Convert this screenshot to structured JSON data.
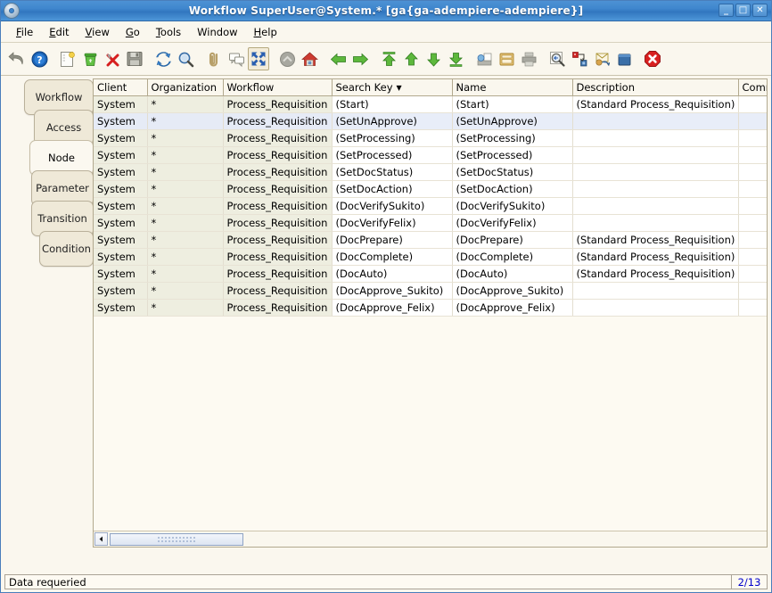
{
  "window": {
    "title": "Workflow  SuperUser@System.* [ga{ga-adempiere-adempiere}]",
    "icon": "disc-icon",
    "buttons": {
      "minimize": "_",
      "maximize": "□",
      "close": "✕"
    }
  },
  "menu": [
    {
      "label": "File",
      "mnemonic": "F"
    },
    {
      "label": "Edit",
      "mnemonic": "E"
    },
    {
      "label": "View",
      "mnemonic": "V"
    },
    {
      "label": "Go",
      "mnemonic": "G"
    },
    {
      "label": "Tools",
      "mnemonic": "T"
    },
    {
      "label": "Window",
      "mnemonic": ""
    },
    {
      "label": "Help",
      "mnemonic": "H"
    }
  ],
  "toolbar": [
    {
      "name": "undo-icon",
      "tooltip": "Undo"
    },
    {
      "name": "help-icon",
      "tooltip": "Help"
    },
    {
      "name": "new-record-icon",
      "tooltip": "New Record"
    },
    {
      "name": "delete-record-icon",
      "tooltip": "Delete Record"
    },
    {
      "name": "delete-selection-icon",
      "tooltip": "Delete Selection"
    },
    {
      "name": "save-icon",
      "tooltip": "Save Changes"
    },
    {
      "name": "refresh-icon",
      "tooltip": "Refresh"
    },
    {
      "name": "find-icon",
      "tooltip": "Find Records"
    },
    {
      "name": "attachment-icon",
      "tooltip": "Attachment"
    },
    {
      "name": "chat-icon",
      "tooltip": "Chat"
    },
    {
      "name": "zoom-across-icon",
      "tooltip": "Zoom Across",
      "selected": true
    },
    {
      "name": "archive-icon",
      "tooltip": "Archive"
    },
    {
      "name": "home-icon",
      "tooltip": "Home"
    },
    {
      "name": "back-icon",
      "tooltip": "Back"
    },
    {
      "name": "forward-icon",
      "tooltip": "Forward"
    },
    {
      "name": "first-record-icon",
      "tooltip": "First Record"
    },
    {
      "name": "previous-record-icon",
      "tooltip": "Previous Record"
    },
    {
      "name": "next-record-icon",
      "tooltip": "Next Record"
    },
    {
      "name": "last-record-icon",
      "tooltip": "Last Record"
    },
    {
      "name": "print-preview-icon",
      "tooltip": "Print Preview"
    },
    {
      "name": "report-icon",
      "tooltip": "Report"
    },
    {
      "name": "print-icon",
      "tooltip": "Print"
    },
    {
      "name": "zoom-query-icon",
      "tooltip": "Zoom Query"
    },
    {
      "name": "active-workflow-icon",
      "tooltip": "Active Workflow"
    },
    {
      "name": "request-icon",
      "tooltip": "Requests"
    },
    {
      "name": "product-info-icon",
      "tooltip": "Product Info"
    },
    {
      "name": "exit-icon",
      "tooltip": "Exit"
    }
  ],
  "tabs": [
    {
      "label": "Workflow",
      "active": false
    },
    {
      "label": "Access",
      "active": false
    },
    {
      "label": "Node",
      "active": true
    },
    {
      "label": "Parameter",
      "active": false
    },
    {
      "label": "Transition",
      "active": false
    },
    {
      "label": "Condition",
      "active": false
    }
  ],
  "grid": {
    "columns": [
      {
        "label": "Client",
        "readonly": true,
        "width": 60
      },
      {
        "label": "Organization",
        "readonly": true,
        "width": 85
      },
      {
        "label": "Workflow",
        "readonly": true,
        "width": 122
      },
      {
        "label": "Search Key",
        "readonly": false,
        "width": 135,
        "sorted": true,
        "sort_dir": "▼"
      },
      {
        "label": "Name",
        "readonly": false,
        "width": 135
      },
      {
        "label": "Description",
        "readonly": false,
        "width": 186
      },
      {
        "label": "Comm",
        "readonly": false,
        "width": 48
      }
    ],
    "rows": [
      {
        "selected": false,
        "cells": [
          "System",
          "*",
          "Process_Requisition",
          "(Start)",
          "(Start)",
          "(Standard Process_Requisition)",
          ""
        ]
      },
      {
        "selected": true,
        "cells": [
          "System",
          "*",
          "Process_Requisition",
          "(SetUnApprove)",
          "(SetUnApprove)",
          "",
          ""
        ]
      },
      {
        "selected": false,
        "cells": [
          "System",
          "*",
          "Process_Requisition",
          "(SetProcessing)",
          "(SetProcessing)",
          "",
          ""
        ]
      },
      {
        "selected": false,
        "cells": [
          "System",
          "*",
          "Process_Requisition",
          "(SetProcessed)",
          "(SetProcessed)",
          "",
          ""
        ]
      },
      {
        "selected": false,
        "cells": [
          "System",
          "*",
          "Process_Requisition",
          "(SetDocStatus)",
          "(SetDocStatus)",
          "",
          ""
        ]
      },
      {
        "selected": false,
        "cells": [
          "System",
          "*",
          "Process_Requisition",
          "(SetDocAction)",
          "(SetDocAction)",
          "",
          ""
        ]
      },
      {
        "selected": false,
        "cells": [
          "System",
          "*",
          "Process_Requisition",
          "(DocVerifySukito)",
          "(DocVerifySukito)",
          "",
          ""
        ]
      },
      {
        "selected": false,
        "cells": [
          "System",
          "*",
          "Process_Requisition",
          "(DocVerifyFelix)",
          "(DocVerifyFelix)",
          "",
          ""
        ]
      },
      {
        "selected": false,
        "cells": [
          "System",
          "*",
          "Process_Requisition",
          "(DocPrepare)",
          "(DocPrepare)",
          "(Standard Process_Requisition)",
          ""
        ]
      },
      {
        "selected": false,
        "cells": [
          "System",
          "*",
          "Process_Requisition",
          "(DocComplete)",
          "(DocComplete)",
          "(Standard Process_Requisition)",
          ""
        ]
      },
      {
        "selected": false,
        "cells": [
          "System",
          "*",
          "Process_Requisition",
          "(DocAuto)",
          "(DocAuto)",
          "(Standard Process_Requisition)",
          ""
        ]
      },
      {
        "selected": false,
        "cells": [
          "System",
          "*",
          "Process_Requisition",
          "(DocApprove_Sukito)",
          "(DocApprove_Sukito)",
          "",
          ""
        ]
      },
      {
        "selected": false,
        "cells": [
          "System",
          "*",
          "Process_Requisition",
          "(DocApprove_Felix)",
          "(DocApprove_Felix)",
          "",
          ""
        ]
      }
    ]
  },
  "scrollbar": {
    "left_arrow": "◀",
    "thumb_position": 0
  },
  "status": {
    "message": "Data requeried",
    "record_count": "2/13"
  },
  "colors": {
    "titlebar": "#3f86cd",
    "app_background": "#faf7ee",
    "readonly_cell": "#eeeee0",
    "editable_cell": "#ffffff",
    "selected_row": "#e8edf8",
    "count_text": "#0000cc"
  }
}
